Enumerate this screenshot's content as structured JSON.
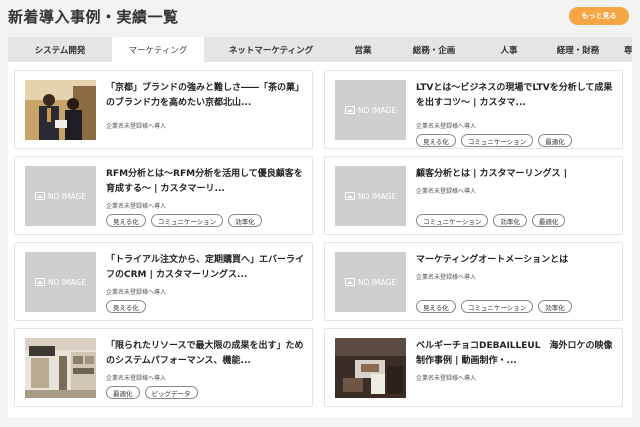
{
  "page": {
    "title": "新着導入事例・実績一覧",
    "more_label": "もっと見る"
  },
  "tabs": [
    {
      "label": "システム開発"
    },
    {
      "label": "マーケティング"
    },
    {
      "label": "ネットマーケティング"
    },
    {
      "label": "営業"
    },
    {
      "label": "総務・企画"
    },
    {
      "label": "人事"
    },
    {
      "label": "経理・財務"
    },
    {
      "label": "専門"
    }
  ],
  "active_tab": "マーケティング",
  "no_image_label": "NO IMAGE",
  "cards": [
    {
      "title": "「京都」ブランドの強みと難しさ――「茶の菓」のブランド力を高めたい京都北山...",
      "company": "企業名未登録様へ導入",
      "tags": [],
      "image": "photo-people"
    },
    {
      "title": "LTVとは〜ビジネスの現場でLTVを分析して成果を出すコツ〜 | カスタマ...",
      "company": "企業名未登録様へ導入",
      "tags": [
        "見える化",
        "コミュニケーション",
        "最適化"
      ],
      "image": "no-image"
    },
    {
      "title": "RFM分析とは〜RFM分析を活用して優良顧客を育成する〜 | カスタマーリ...",
      "company": "企業名未登録様へ導入",
      "tags": [
        "見える化",
        "コミュニケーション",
        "効率化"
      ],
      "image": "no-image"
    },
    {
      "title": "顧客分析とは | カスタマーリングス |",
      "company": "企業名未登録様へ導入",
      "tags": [
        "コミュニケーション",
        "効率化",
        "最適化"
      ],
      "image": "no-image"
    },
    {
      "title": "「トライアル注文から、定期購買へ」エバーライフのCRM | カスタマーリングス...",
      "company": "企業名未登録様へ導入",
      "tags": [
        "見える化"
      ],
      "image": "no-image"
    },
    {
      "title": "マーケティングオートメーションとは",
      "company": "企業名未登録様へ導入",
      "tags": [
        "見える化",
        "コミュニケーション",
        "効率化"
      ],
      "image": "no-image"
    },
    {
      "title": "「限られたリソースで最大限の成果を出す」ためのシステムパフォーマンス、機能...",
      "company": "企業名未登録様へ導入",
      "tags": [
        "最適化",
        "ビッグデータ"
      ],
      "image": "photo-store"
    },
    {
      "title": "ベルギーチョコDEBAILLEUL　海外ロケの映像制作事例 | 動画制作・...",
      "company": "企業名未登録様へ導入",
      "tags": [],
      "image": "photo-chocolate"
    }
  ]
}
